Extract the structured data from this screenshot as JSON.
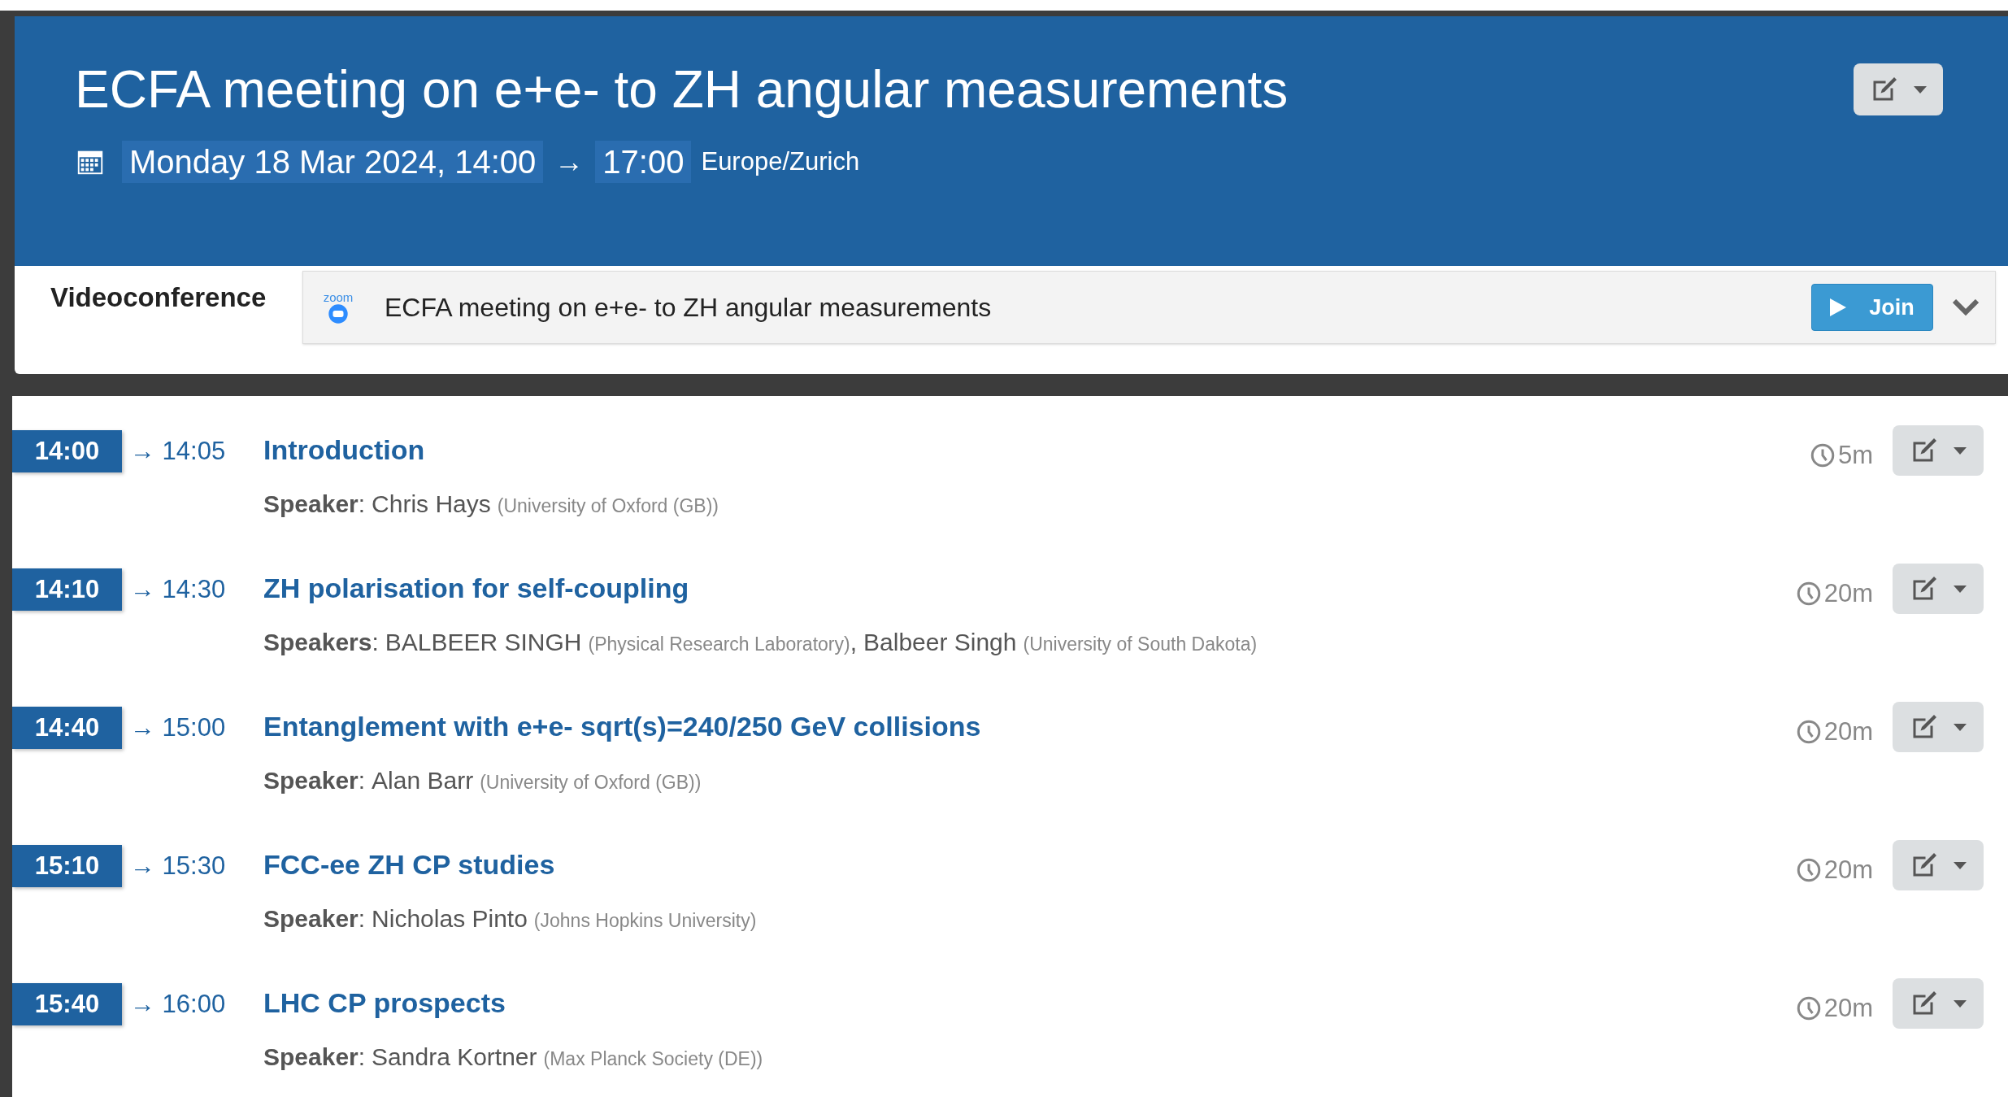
{
  "header": {
    "title": "ECFA meeting on e+e- to ZH angular measurements",
    "start": "Monday 18 Mar 2024, 14:00",
    "arrow": "→",
    "end": "17:00",
    "timezone": "Europe/Zurich"
  },
  "videoconference": {
    "label": "Videoconference",
    "logo_text": "zoom",
    "room": "ECFA meeting on e+e- to ZH angular measurements",
    "join": "Join",
    "expanded": false
  },
  "contributions": [
    {
      "start": "14:00",
      "end": "→ 14:05",
      "title": "Introduction",
      "duration": "5m",
      "speaker_label": "**Speaker**:",
      "speakers": [
        {
          "name": "Chris Hays",
          "affiliation": "(University of Oxford (GB))"
        }
      ]
    },
    {
      "start": "14:10",
      "end": "→ 14:30",
      "title": "ZH polarisation for self-coupling",
      "duration": "20m",
      "speaker_label": "**Speakers**:",
      "separator": ",",
      "speakers": [
        {
          "name": "BALBEER SINGH",
          "affiliation": "(Physical Research Laboratory)"
        },
        {
          "name": "Balbeer Singh",
          "affiliation": "(University of South Dakota)"
        }
      ]
    },
    {
      "start": "14:40",
      "end": "→ 15:00",
      "title": "Entanglement with e+e- sqrt(s)=240/250 GeV collisions",
      "duration": "20m",
      "speaker_label": "**Speaker**:",
      "speakers": [
        {
          "name": "Alan Barr",
          "affiliation": "(University of Oxford (GB))"
        }
      ]
    },
    {
      "start": "15:10",
      "end": "→ 15:30",
      "title": "FCC-ee ZH CP studies",
      "duration": "20m",
      "speaker_label": "**Speaker**:",
      "speakers": [
        {
          "name": "Nicholas Pinto",
          "affiliation": "(Johns Hopkins University)"
        }
      ]
    },
    {
      "start": "15:40",
      "end": "→ 16:00",
      "title": "LHC CP prospects",
      "duration": "20m",
      "speaker_label": "**Speaker**:",
      "speakers": [
        {
          "name": "Sandra Kortner",
          "affiliation": "(Max Planck Society (DE))"
        }
      ]
    }
  ]
}
